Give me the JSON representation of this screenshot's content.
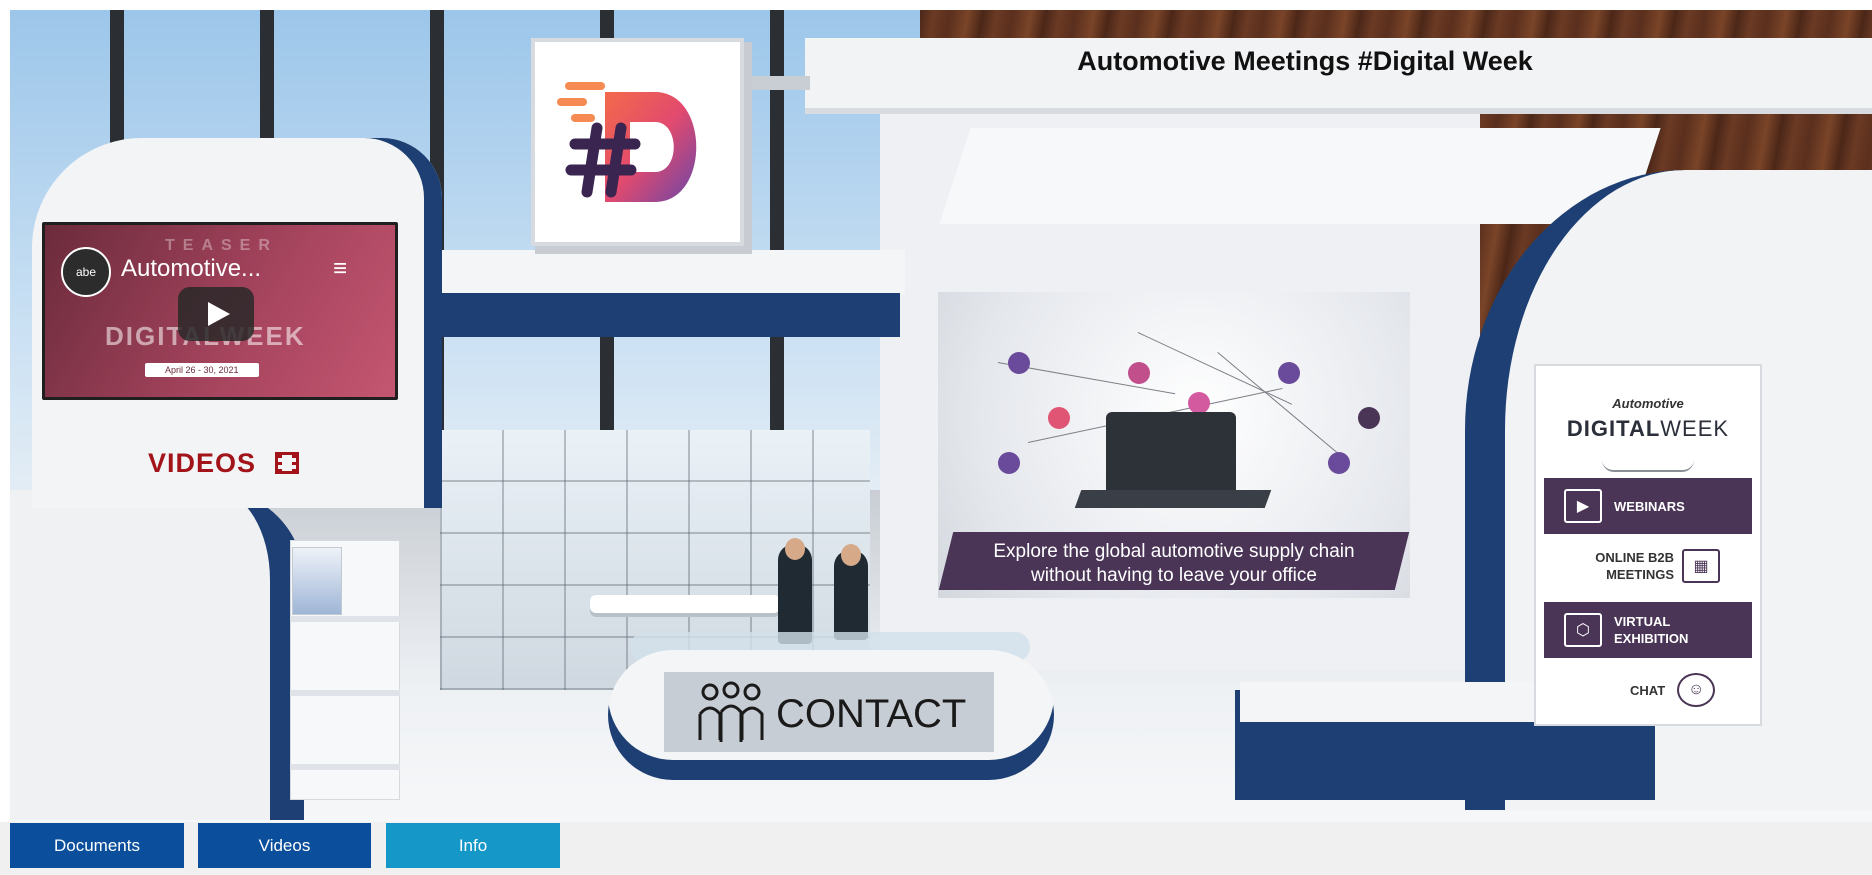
{
  "booth": {
    "title": "Automotive Meetings #Digital Week",
    "videos_label": "VIDEOS",
    "videos_icon": "film-icon",
    "contact_label": "CONTACT",
    "contact_icon": "people-icon"
  },
  "video_player": {
    "title": "Automotive...",
    "channel_badge": "abe",
    "overlay_teaser": "TEASER",
    "overlay_brand": "DIGITALWEEK",
    "overlay_date": "April 26 - 30, 2021",
    "play_icon": "play-icon",
    "playlist_icon": "playlist-icon"
  },
  "center_display": {
    "tagline_line1": "Explore the global automotive supply chain",
    "tagline_line2": "without having to leave your office"
  },
  "poster": {
    "logo_top": "Automotive",
    "logo_main": "DIGITAL",
    "logo_suffix": "WEEK",
    "items": [
      {
        "label": "WEBINARS",
        "icon": "laptop-icon"
      },
      {
        "label": "ONLINE B2B MEETINGS",
        "icon": "meeting-grid-icon"
      },
      {
        "label": "VIRTUAL EXHIBITION",
        "icon": "exhibition-icon"
      },
      {
        "label": "CHAT",
        "icon": "chat-icon"
      }
    ]
  },
  "tabs": [
    {
      "label": "Documents",
      "color": "#0b4f9c"
    },
    {
      "label": "Videos",
      "color": "#0b4f9c"
    },
    {
      "label": "Info",
      "color": "#1597c8"
    }
  ],
  "colors": {
    "booth_blue": "#1e3f73",
    "videos_red": "#a3131a",
    "poster_purple": "#4a3557",
    "tab_bar": "#f0f0f0"
  }
}
